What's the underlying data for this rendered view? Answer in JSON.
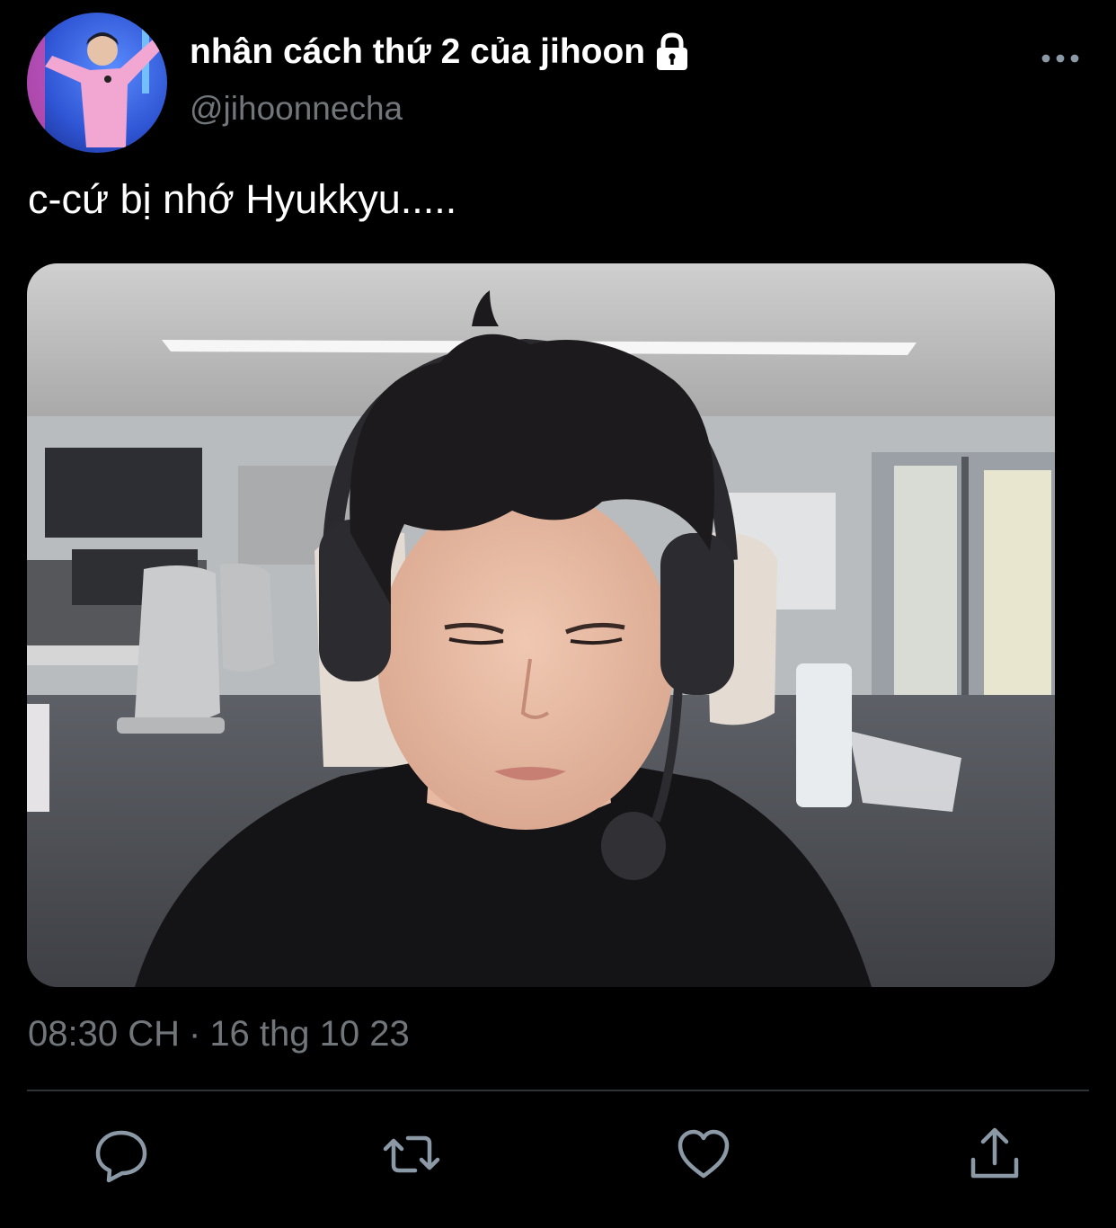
{
  "author": {
    "display_name": "nhân cách thứ 2 của jihoon",
    "handle": "@jihoonnecha",
    "protected_icon": "lock-icon",
    "avatar_icon": "avatar-photo"
  },
  "tweet": {
    "text": "c-cứ bị nhớ Hyukkyu.....",
    "media_icon": "photo-attachment",
    "time": "08:30 CH",
    "separator": "·",
    "date": "16 thg 10 23"
  },
  "actions": [
    {
      "icon": "reply-icon"
    },
    {
      "icon": "retweet-icon"
    },
    {
      "icon": "like-icon"
    },
    {
      "icon": "share-icon"
    }
  ],
  "menu_icon": "more-options-icon",
  "colors": {
    "background": "#000000",
    "primary_text": "#ffffff",
    "secondary_text": "#71767b",
    "divider": "#2f3336"
  }
}
